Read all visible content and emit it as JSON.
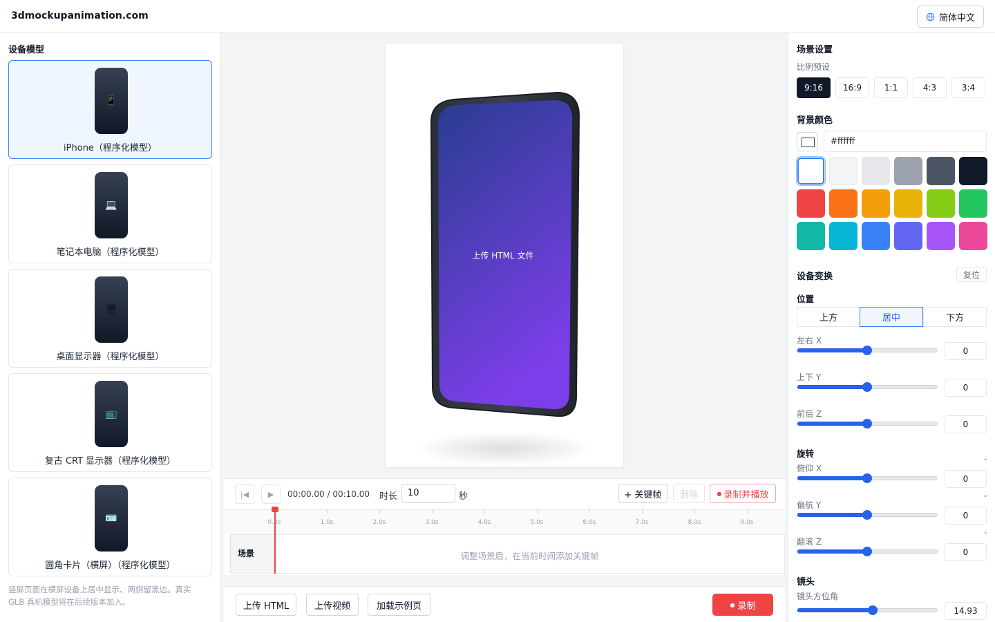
{
  "header": {
    "brand": "3dmockupanimation.com",
    "language": "简体中文",
    "language_icon": "globe-icon"
  },
  "devices": {
    "title": "设备模型",
    "items": [
      {
        "label": "iPhone（程序化模型）",
        "icon": "📱",
        "active": true
      },
      {
        "label": "笔记本电脑（程序化模型）",
        "icon": "💻",
        "active": false
      },
      {
        "label": "桌面显示器（程序化模型）",
        "icon": "🖥",
        "active": false
      },
      {
        "label": "复古 CRT 显示器（程序化模型）",
        "icon": "📺",
        "active": false
      },
      {
        "label": "圆角卡片（横屏）（程序化模型）",
        "icon": "🪪",
        "active": false
      }
    ],
    "note": "竖屏页面在横屏设备上居中显示、两侧留黑边。真实 GLB 真机模型将在后续版本加入。"
  },
  "preview": {
    "screen_text": "上传 HTML 文件",
    "screen_gradient_start": "#283d8f",
    "screen_gradient_end": "#7b3ee8"
  },
  "timeline": {
    "current_time": "00:00.00",
    "total_time": "00:10.00",
    "time_separator": " / ",
    "duration_label": "时长",
    "duration_value": "10",
    "duration_unit": "秒",
    "add_keyframe": "+ 关键帧",
    "delete": "删除",
    "record_play": "录制并播放",
    "ticks": [
      "0.0s",
      "1.0s",
      "2.0s",
      "3.0s",
      "4.0s",
      "5.0s",
      "6.0s",
      "7.0s",
      "8.0s",
      "9.0s"
    ],
    "track_label": "场景",
    "track_hint": "调整场景后，在当前时间添加关键帧",
    "playhead_time": 0
  },
  "bottom": {
    "upload_html": "上传 HTML",
    "upload_video": "上传视频",
    "load_example": "加载示例页",
    "record": "录制"
  },
  "scene": {
    "title": "场景设置",
    "ratio_label": "比例预设",
    "ratios": [
      "9:16",
      "16:9",
      "1:1",
      "4:3",
      "3:4"
    ],
    "active_ratio": "9:16",
    "bg_title": "背景颜色",
    "bg_value": "#ffffff",
    "swatches": [
      "#ffffff",
      "#f3f4f6",
      "#e5e7eb",
      "#9ca3af",
      "#4b5563",
      "#111827",
      "#ef4444",
      "#f97316",
      "#f59e0b",
      "#eab308",
      "#84cc16",
      "#22c55e",
      "#14b8a6",
      "#06b6d4",
      "#3b82f6",
      "#6366f1",
      "#a855f7",
      "#ec4899"
    ],
    "selected_swatch": "#ffffff"
  },
  "transform": {
    "title": "设备变换",
    "reset": "复位",
    "position_title": "位置",
    "position_options": [
      "上方",
      "居中",
      "下方"
    ],
    "active_position": "居中",
    "sliders_position": [
      {
        "label": "左右 X",
        "value": "0",
        "fraction": 0.5
      },
      {
        "label": "上下 Y",
        "value": "0",
        "fraction": 0.5
      },
      {
        "label": "前后 Z",
        "value": "0",
        "fraction": 0.5
      }
    ],
    "rotation_title": "旋转",
    "degree_symbol": "°",
    "sliders_rotation": [
      {
        "label": "俯仰 X",
        "value": "0",
        "fraction": 0.5
      },
      {
        "label": "偏航 Y",
        "value": "0",
        "fraction": 0.5
      },
      {
        "label": "翻滚 Z",
        "value": "0",
        "fraction": 0.5
      }
    ]
  },
  "camera": {
    "title": "镜头",
    "azimuth_label": "镜头方位角",
    "azimuth_value": "14.93",
    "azimuth_fraction": 0.54
  }
}
